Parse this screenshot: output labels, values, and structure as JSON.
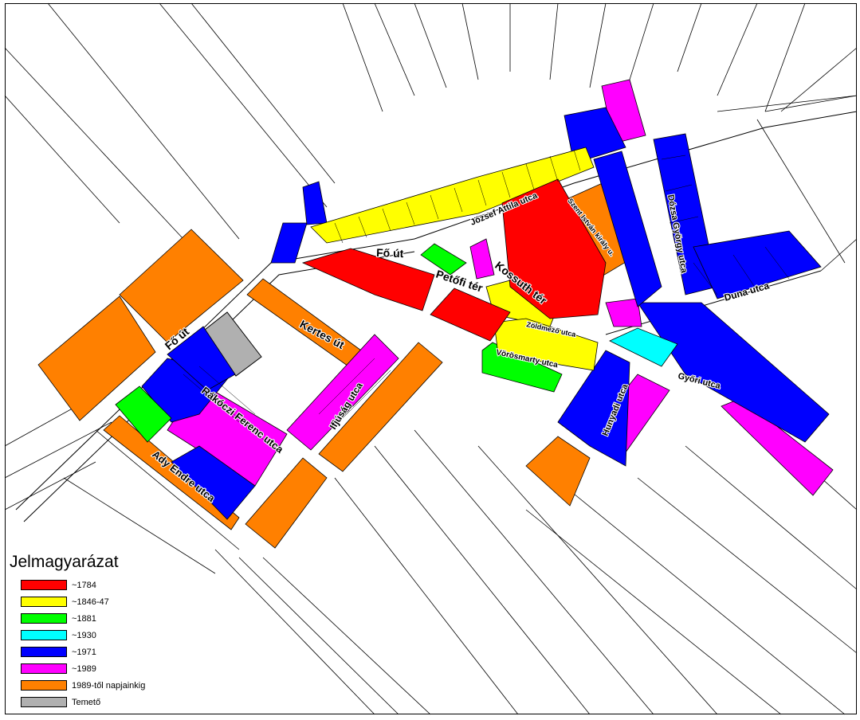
{
  "legend": {
    "title": "Jelmagyarázat",
    "items": [
      {
        "label": "~1784",
        "color": "#ff0000"
      },
      {
        "label": "~1846-47",
        "color": "#ffff00"
      },
      {
        "label": "~1881",
        "color": "#00ff00"
      },
      {
        "label": "~1930",
        "color": "#00ffff"
      },
      {
        "label": "~1971",
        "color": "#0000ff"
      },
      {
        "label": "~1989",
        "color": "#ff00ff"
      },
      {
        "label": "1989-től napjainkig",
        "color": "#ff8000"
      },
      {
        "label": "Temető",
        "color": "#b0b0b0"
      }
    ]
  },
  "streets": {
    "fo_ut_1": "Fő út",
    "fo_ut_2": "Fő út",
    "petofi_ter": "Petőfi tér",
    "kossuth_ter": "Kossuth tér",
    "jozsef_attila_utca": "József Attila utca",
    "szent_istvan_kiraly": "Szent István király u.",
    "dozsa_gyorgy_utca": "Dózsa György utca",
    "duna_utca": "Duna utca",
    "zoldmezo_utca": "Zöldmező utca",
    "vorosmarty_utca": "Vörösmarty utca",
    "gyori_utca": "Győri utca",
    "hunyadi_utca": "Hunyadi utca",
    "kertes_ut": "Kertes út",
    "ifjusag_utca": "Ifjúság utca",
    "rakoczi_ferenc_utca": "Rákóczi Ferenc utca",
    "ady_endre_utca": "Ady Endre utca"
  }
}
